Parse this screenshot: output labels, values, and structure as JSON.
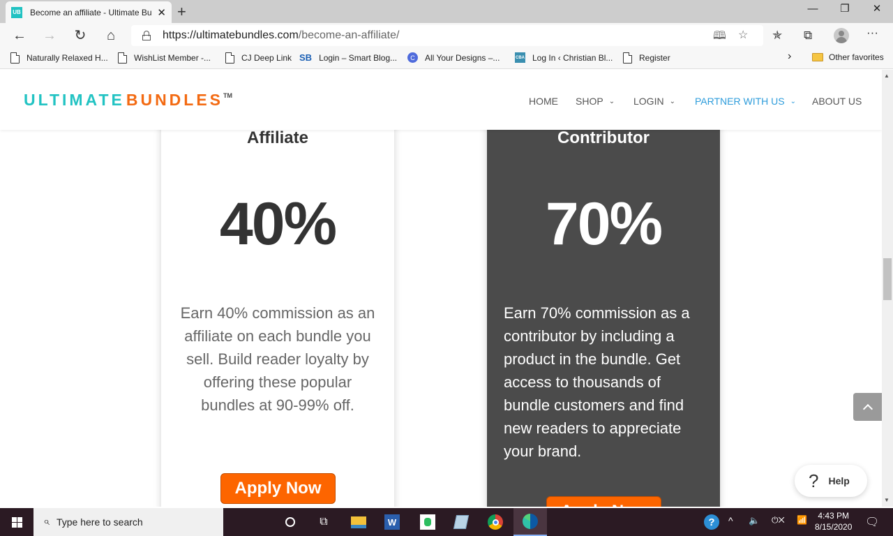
{
  "browser": {
    "tab_title": "Become an affiliate - Ultimate Bu",
    "tab_favicon": "UB",
    "new_tab_icon": "+",
    "window_controls": {
      "minimize": "—",
      "restore": "❐",
      "close": "✕"
    },
    "url_host": "https://ultimatebundles.com",
    "url_path": "/become-an-affiliate/",
    "nav_icons": {
      "back": "←",
      "forward": "→",
      "refresh": "↻",
      "home": "⌂"
    },
    "toolbar_icons": {
      "read_aloud": "🕮",
      "add_favorite": "☆",
      "favorites": "✯",
      "collections": "⧉",
      "more": "···"
    },
    "favorites": [
      {
        "label": "Naturally Relaxed H...",
        "icon": "page-icon"
      },
      {
        "label": "WishList Member -...",
        "icon": "page-icon"
      },
      {
        "label": "CJ Deep Link",
        "icon": "page-icon"
      },
      {
        "label": "Login – Smart Blog...",
        "icon": "sb-icon",
        "icon_text": "SB"
      },
      {
        "label": "All Your Designs –...",
        "icon": "c-icon",
        "icon_text": "C"
      },
      {
        "label": "Log In ‹ Christian Bl...",
        "icon": "cba-icon",
        "icon_text": "CBA"
      },
      {
        "label": "Register",
        "icon": "page-icon"
      }
    ],
    "favorites_overflow": "›",
    "other_favorites": "Other favorites"
  },
  "site": {
    "logo_part1": "ULTIMATE",
    "logo_part2": "BUNDLES",
    "logo_tm": "TM",
    "nav": [
      {
        "label": "HOME",
        "dropdown": false,
        "active": false
      },
      {
        "label": "SHOP",
        "dropdown": true,
        "active": false
      },
      {
        "label": "LOGIN",
        "dropdown": true,
        "active": false
      },
      {
        "label": "PARTNER WITH US",
        "dropdown": true,
        "active": true
      },
      {
        "label": "ABOUT US",
        "dropdown": false,
        "active": false
      }
    ],
    "chevron": "⌄",
    "colors": {
      "teal": "#22c3c3",
      "orange": "#f36a12",
      "active_nav": "#2d9cdb",
      "button": "#fd6500",
      "dark_card": "#4b4b4b"
    }
  },
  "cards": {
    "affiliate": {
      "title": "Affiliate",
      "percent": "40%",
      "description": "Earn 40% commission as an affiliate on each bundle you sell. Build reader loyalty by offering these popular bundles at 90-99% off.",
      "button": "Apply Now"
    },
    "contributor": {
      "title": "Contributor",
      "percent": "70%",
      "description": "Earn 70% commission as a contributor by including a product in the bundle. Get access to thousands of bundle customers and find new readers to appreciate your brand.",
      "button": "Apply Now"
    }
  },
  "widgets": {
    "help_icon": "?",
    "help_label": "Help"
  },
  "taskbar": {
    "search_placeholder": "Type here to search",
    "search_icon": "⌕",
    "apps": [
      "cortana",
      "task-view",
      "file-explorer",
      "word",
      "evernote",
      "notes",
      "chrome",
      "edge"
    ],
    "tray_icons": {
      "chevron": "^",
      "volume": "🔈",
      "network": "📶"
    },
    "time": "4:43 PM",
    "date": "8/15/2020"
  }
}
